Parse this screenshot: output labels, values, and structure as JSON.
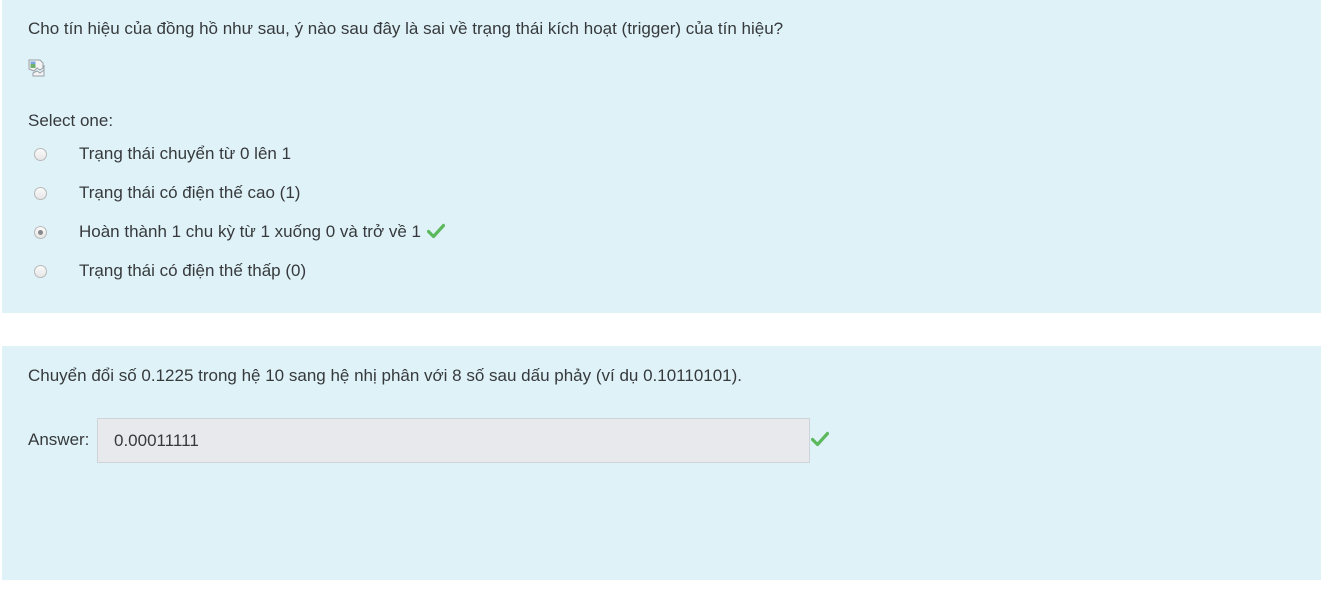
{
  "question1": {
    "text": "Cho tín hiệu của đồng hồ như sau, ý nào sau đây là sai về trạng thái kích hoạt (trigger) của tín hiệu?",
    "select_label": "Select one:",
    "options": [
      {
        "label": "Trạng thái chuyển từ 0 lên 1",
        "selected": false
      },
      {
        "label": "Trạng thái có điện thế cao (1)",
        "selected": false
      },
      {
        "label": "Hoàn thành 1 chu kỳ từ 1 xuống 0 và trở về 1",
        "selected": true,
        "correct": true
      },
      {
        "label": "Trạng thái có điện thế thấp (0)",
        "selected": false
      }
    ]
  },
  "question2": {
    "text": "Chuyển đổi số 0.1225 trong hệ 10 sang hệ nhị phân với 8 số sau dấu phảy (ví dụ 0.10110101).",
    "answer_label": "Answer:",
    "answer_value": "0.00011111",
    "correct": true
  },
  "colors": {
    "panel_bg": "#def2f8",
    "correct_check": "#5cb85c",
    "text": "#373a3c"
  },
  "icons": {
    "broken_image": "broken-image-icon",
    "correct": "check-icon"
  }
}
